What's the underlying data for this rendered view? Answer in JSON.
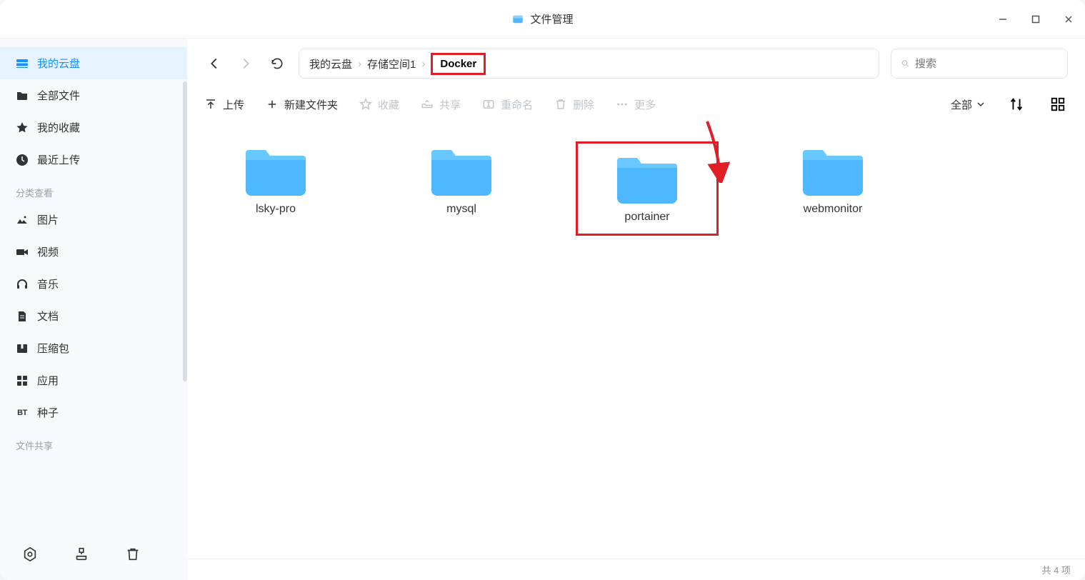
{
  "window": {
    "title": "文件管理"
  },
  "sidebar": {
    "items": [
      {
        "label": "我的云盘"
      },
      {
        "label": "全部文件"
      },
      {
        "label": "我的收藏"
      },
      {
        "label": "最近上传"
      }
    ],
    "section_label": "分类查看",
    "categories": [
      {
        "label": "图片"
      },
      {
        "label": "视频"
      },
      {
        "label": "音乐"
      },
      {
        "label": "文档"
      },
      {
        "label": "压缩包"
      },
      {
        "label": "应用"
      },
      {
        "label": "种子",
        "prefix": "BT"
      }
    ],
    "share_label": "文件共享"
  },
  "breadcrumb": {
    "items": [
      "我的云盘",
      "存储空间1",
      "Docker"
    ]
  },
  "search": {
    "placeholder": "搜索"
  },
  "toolbar": {
    "upload": "上传",
    "new_folder": "新建文件夹",
    "favorite": "收藏",
    "share": "共享",
    "rename": "重命名",
    "delete": "删除",
    "more": "更多",
    "filter": "全部"
  },
  "folders": [
    {
      "name": "lsky-pro"
    },
    {
      "name": "mysql"
    },
    {
      "name": "portainer"
    },
    {
      "name": "webmonitor"
    }
  ],
  "status": {
    "count_text": "共 4 项"
  }
}
